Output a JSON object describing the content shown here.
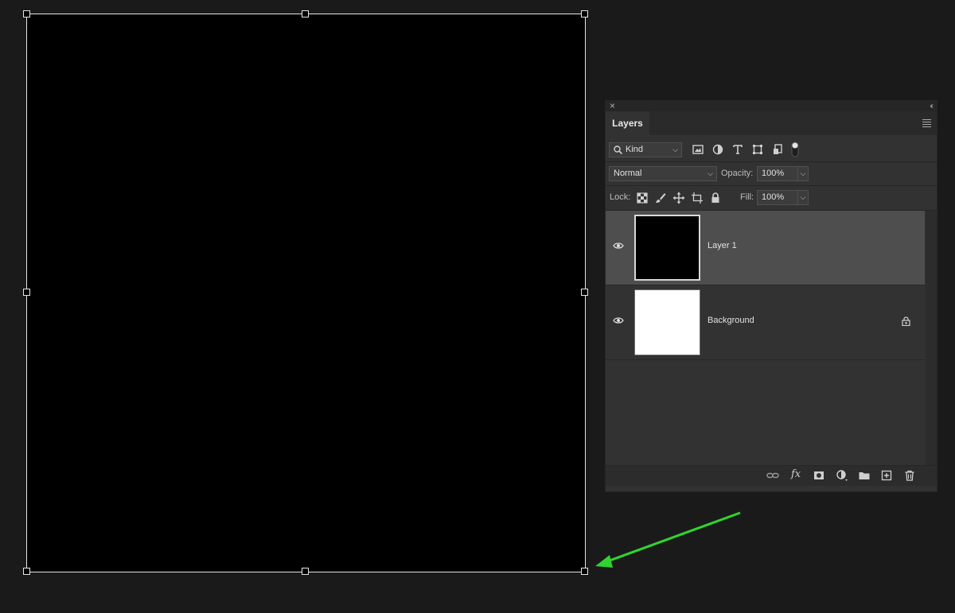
{
  "panel": {
    "tab_label": "Layers",
    "close_icon": "close-icon",
    "collapse_icon": "collapse-icon",
    "menu_icon": "panel-menu-icon"
  },
  "filter": {
    "kind_label": "Kind",
    "icons": [
      "image-filter-icon",
      "adjustment-filter-icon",
      "type-filter-icon",
      "shape-filter-icon",
      "smart-object-filter-icon",
      "filter-toggle-icon"
    ]
  },
  "blend": {
    "mode": "Normal",
    "opacity_label": "Opacity:",
    "opacity_value": "100%"
  },
  "lock": {
    "label": "Lock:",
    "fill_label": "Fill:",
    "fill_value": "100%"
  },
  "layers": [
    {
      "name": "Layer 1",
      "selected": true,
      "thumb": "black",
      "locked": false
    },
    {
      "name": "Background",
      "selected": false,
      "thumb": "white",
      "locked": true
    }
  ],
  "footer_icons": [
    "link-layers-icon",
    "fx-icon",
    "add-mask-icon",
    "adjustment-layer-icon",
    "new-group-icon",
    "new-layer-icon",
    "delete-layer-icon"
  ],
  "footer": {
    "fx_label": "fx"
  },
  "colors": {
    "accent_arrow": "#2fd42f",
    "canvas": "#000000",
    "panel_bg": "#323232",
    "selected_layer": "#4e4e4e"
  }
}
